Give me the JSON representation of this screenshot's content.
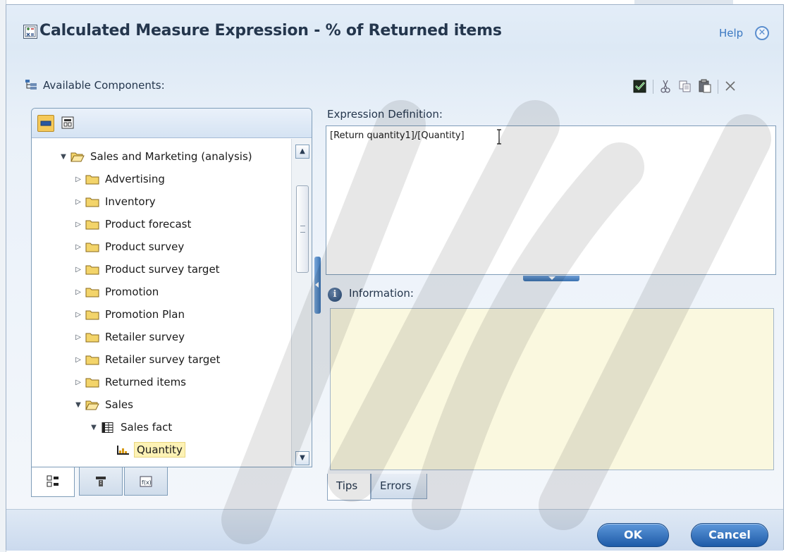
{
  "dialog": {
    "title": "Calculated Measure Expression - % of Returned items",
    "help_label": "Help",
    "close_glyph": "✕"
  },
  "components": {
    "label": "Available Components:",
    "tree": [
      {
        "label": "Sales and Marketing (analysis)",
        "level": 0,
        "expanded": true,
        "icon": "folder-open-icon"
      },
      {
        "label": "Advertising",
        "level": 1,
        "expanded": false,
        "icon": "folder-icon"
      },
      {
        "label": "Inventory",
        "level": 1,
        "expanded": false,
        "icon": "folder-icon"
      },
      {
        "label": "Product forecast",
        "level": 1,
        "expanded": false,
        "icon": "folder-icon"
      },
      {
        "label": "Product survey",
        "level": 1,
        "expanded": false,
        "icon": "folder-icon"
      },
      {
        "label": "Product survey target",
        "level": 1,
        "expanded": false,
        "icon": "folder-icon"
      },
      {
        "label": "Promotion",
        "level": 1,
        "expanded": false,
        "icon": "folder-icon"
      },
      {
        "label": "Promotion Plan",
        "level": 1,
        "expanded": false,
        "icon": "folder-icon"
      },
      {
        "label": "Retailer survey",
        "level": 1,
        "expanded": false,
        "icon": "folder-icon"
      },
      {
        "label": "Retailer survey target",
        "level": 1,
        "expanded": false,
        "icon": "folder-icon"
      },
      {
        "label": "Returned items",
        "level": 1,
        "expanded": false,
        "icon": "folder-icon"
      },
      {
        "label": "Sales",
        "level": 1,
        "expanded": true,
        "icon": "folder-open-icon"
      },
      {
        "label": "Sales fact",
        "level": 2,
        "expanded": true,
        "icon": "fact-table-icon"
      },
      {
        "label": "Quantity",
        "level": 3,
        "expanded": null,
        "icon": "measure-icon",
        "selected": true
      }
    ],
    "scroll": {
      "thumb_fraction": 0.27
    }
  },
  "expression": {
    "label": "Expression Definition:",
    "value": "[Return quantity1]/[Quantity]"
  },
  "information": {
    "label": "Information:",
    "tabs": [
      "Tips",
      "Errors"
    ],
    "active_tab": "Tips"
  },
  "footer": {
    "ok_label": "OK",
    "cancel_label": "Cancel"
  },
  "colors": {
    "accent": "#2f6bb5",
    "info_bg": "#faf8df",
    "selection": "#fdf2b5"
  }
}
